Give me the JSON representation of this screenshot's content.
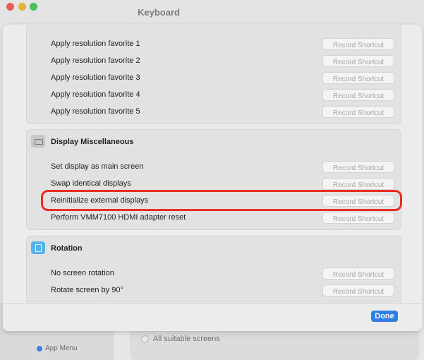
{
  "window": {
    "title": "Keyboard"
  },
  "sidebar": {
    "app_menu_label": "App Menu"
  },
  "background": {
    "all_screens_label": "All suitable screens"
  },
  "sections": {
    "favorites": {
      "rows": [
        {
          "label": "Apply resolution favorite 1",
          "button": "Record Shortcut"
        },
        {
          "label": "Apply resolution favorite 2",
          "button": "Record Shortcut"
        },
        {
          "label": "Apply resolution favorite 3",
          "button": "Record Shortcut"
        },
        {
          "label": "Apply resolution favorite 4",
          "button": "Record Shortcut"
        },
        {
          "label": "Apply resolution favorite 5",
          "button": "Record Shortcut"
        }
      ]
    },
    "display_misc": {
      "title": "Display Miscellaneous",
      "rows": [
        {
          "label": "Set display as main screen",
          "button": "Record Shortcut"
        },
        {
          "label": "Swap identical displays",
          "button": "Record Shortcut"
        },
        {
          "label": "Reinitialize external displays",
          "button": "Record Shortcut"
        },
        {
          "label": "Perform VMM7100 HDMI adapter reset",
          "button": "Record Shortcut"
        }
      ]
    },
    "rotation": {
      "title": "Rotation",
      "rows": [
        {
          "label": "No screen rotation",
          "button": "Record Shortcut"
        },
        {
          "label": "Rotate screen by 90°",
          "button": "Record Shortcut"
        }
      ]
    }
  },
  "footer": {
    "done_label": "Done"
  },
  "colors": {
    "accent": "#2f7fe6",
    "highlight": "#ea2f22",
    "rotation_icon": "#54b3ea"
  },
  "icons": {
    "display_misc": "display-icon",
    "rotation": "rotation-icon"
  }
}
